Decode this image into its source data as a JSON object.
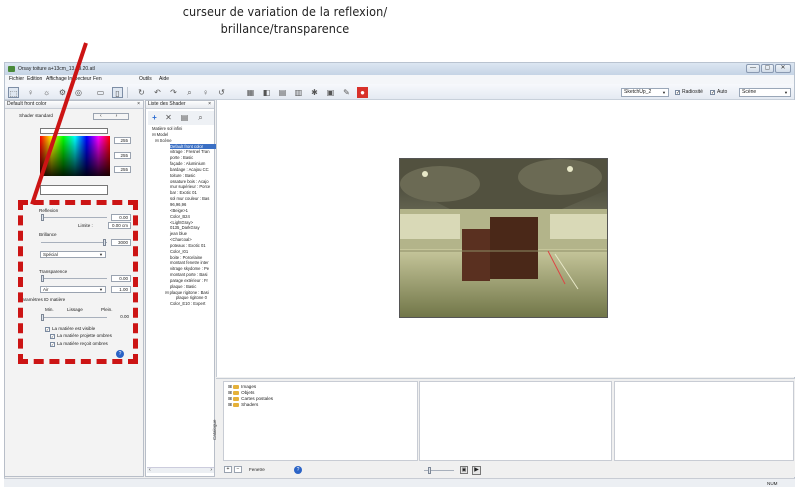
{
  "annotation": {
    "caption_line1": "curseur de variation de la reflexion/",
    "caption_line2": "brillance/transparence"
  },
  "window": {
    "title": "Orsay toiture a+13cm_13.09.20.atl",
    "min": "—",
    "max": "▢",
    "close": "✕"
  },
  "menu": {
    "items": [
      "Fichier",
      "Edition",
      "Affichage",
      "Inspecteur",
      "Fen",
      "Outils",
      "Aide"
    ]
  },
  "toolbar": {
    "sketchup_combo": "SketchUp_2",
    "radiosite_label": "Radiosité",
    "auto_label": "Auto",
    "scene_combo": "Scène"
  },
  "shader_panel": {
    "header": "Default front color",
    "close": "×",
    "shader_type": "Shader standard",
    "rgb": [
      "255",
      "255",
      "255"
    ],
    "reflexion_label": "Reflexion",
    "reflexion_value": "0.00",
    "limite_label": "Limite :",
    "limite_value": "0.00 cm",
    "brillance_label": "Brillance",
    "brillance_value": "3000",
    "brillance_mode": "Spécial",
    "transparence_label": "Transparence",
    "transparence_value": "0.00",
    "ior_value": "1.00",
    "ior_mode": "Air",
    "id_params_label": "Paramètres ID matière",
    "col_min": "Min.",
    "col_lissage": "Lissage",
    "col_plein": "Plein.",
    "lissage_value": "0.00",
    "visible_label": "La matière est visible",
    "projette_label": "La matière projette ombres",
    "recoit_label": "La matière reçoit ombres",
    "help": "?"
  },
  "list_panel": {
    "header": "Liste des Shader",
    "close": "×",
    "items": [
      "Matière sol infini",
      "⊟ Model",
      "  ⊟ Scène",
      "Default front color",
      "vitrage : Fresnel Tran",
      "porte : Basic",
      "façade : Aluminium",
      "bardage : Acajou CC",
      "toiture : Basic",
      "ossature bois : Acajo",
      "mur supérieur : Porce",
      "bar : Exotic 01",
      "sol mur couleur : Bas",
      "96,96,96",
      "<Beige>1",
      "Color_B24",
      "<LightGray>",
      "0135_DarkGray",
      "jean blue",
      "<Charcoal>",
      "poteaux : Exotic 01",
      "Color_I01",
      "boite : Porcelaine",
      "montant fenetre inter",
      "vitrage skydome : Pe",
      "montant porte : Basi",
      "parage extérieur : Fr",
      "plaque : Basic",
      "⊟ plaque rigitone : Basi",
      "plaque rigitone 0",
      "Color_E10 : Expert"
    ]
  },
  "catalogue": {
    "side_label": "Catalogue",
    "items": [
      "Images",
      "Objets",
      "Cartes postales",
      "Shaders"
    ],
    "fenetre_label": "Fenetre",
    "help": "?"
  },
  "status": {
    "num": "NUM"
  }
}
